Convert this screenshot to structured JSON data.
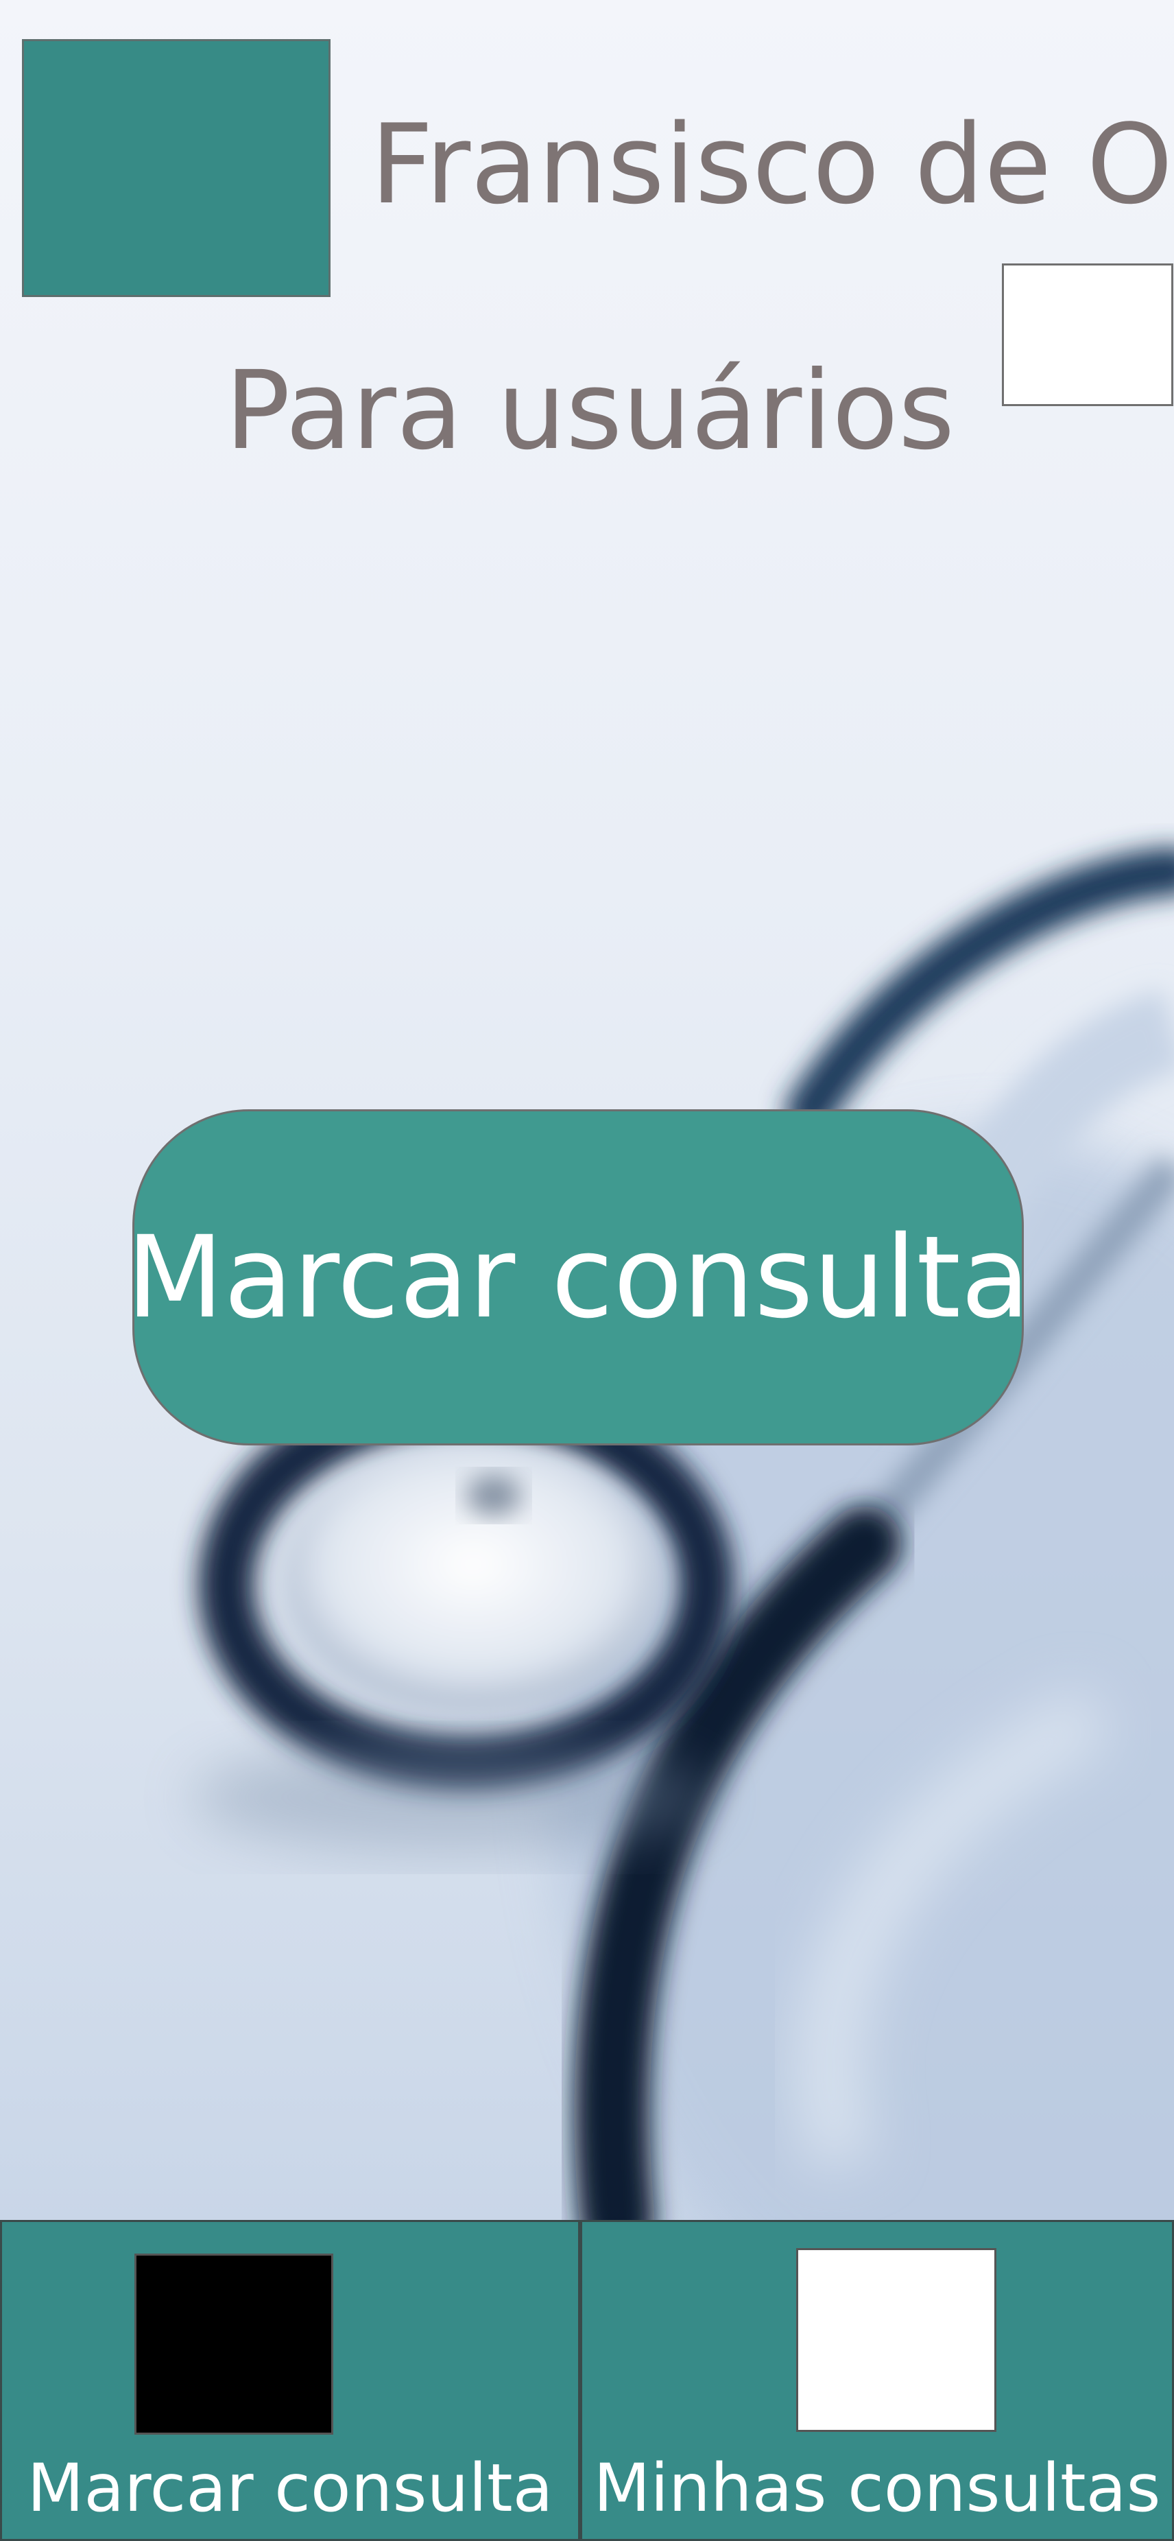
{
  "header": {
    "user_name": "Fransisco de O.",
    "subtitle": "Para usuários",
    "avatar_icon": "avatar-placeholder",
    "menu_icon": "menu-placeholder"
  },
  "main": {
    "cta_label": "Marcar consulta",
    "background_image": "stethoscope"
  },
  "bottom_nav": {
    "items": [
      {
        "label": "Marcar consulta",
        "icon": "calendar-placeholder-icon"
      },
      {
        "label": "Minhas consultas",
        "icon": "list-placeholder-icon"
      }
    ]
  },
  "colors": {
    "accent": "#378b86",
    "button": "#409a90",
    "text_muted": "#7e7474"
  }
}
